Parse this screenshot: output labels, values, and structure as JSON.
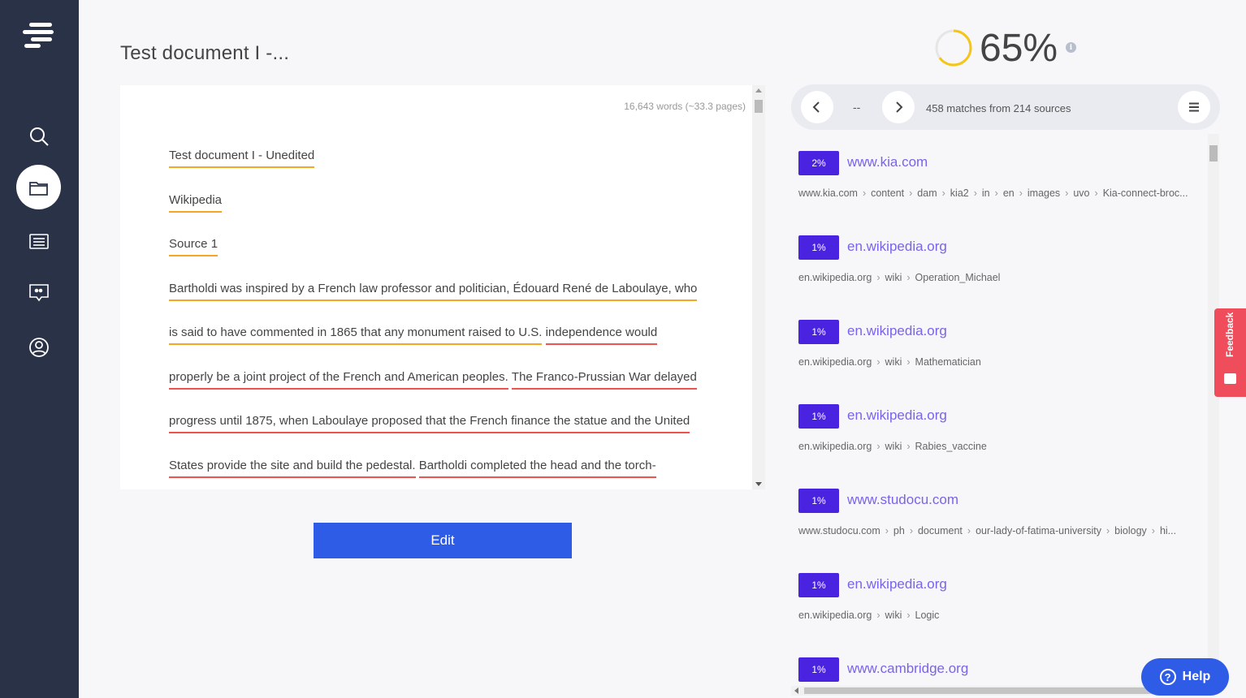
{
  "sidebar": {
    "logo": "copyleaks-logo",
    "items": [
      {
        "icon": "search-icon"
      },
      {
        "icon": "folder-icon",
        "active": true
      },
      {
        "icon": "list-icon"
      },
      {
        "icon": "quote-bubble-icon"
      },
      {
        "icon": "user-icon"
      }
    ]
  },
  "document": {
    "title": "Test document I -...",
    "word_count": "16,643 words (~33.3 pages)",
    "lines": [
      [
        {
          "t": "Test document I - Unedited",
          "c": "orange"
        }
      ],
      [
        {
          "t": "Wikipedia",
          "c": "orange"
        }
      ],
      [
        {
          "t": "Source 1",
          "c": "orange"
        }
      ],
      [
        {
          "t": "Bartholdi was inspired by a French law professor and politician, Édouard René de Laboulaye, who",
          "c": "orange"
        }
      ],
      [
        {
          "t": "is said to have commented in 1865 that any monument raised to U.S.",
          "c": "orange"
        },
        {
          "t": "independence would",
          "c": "red"
        }
      ],
      [
        {
          "t": "properly be a joint project of the French and American peoples.",
          "c": "red"
        },
        {
          "t": "The Franco-Prussian War delayed",
          "c": "red"
        }
      ],
      [
        {
          "t": "progress until 1875, when Laboulaye proposed that the French finance the statue and the United",
          "c": "red"
        }
      ],
      [
        {
          "t": "States provide the site and build the pedestal.",
          "c": "red"
        },
        {
          "t": "Bartholdi completed the head and the torch-",
          "c": "red"
        }
      ]
    ],
    "edit_label": "Edit"
  },
  "score": {
    "value": "65%",
    "fraction": 0.65,
    "ring_color": "#f5c518",
    "info_icon": "i"
  },
  "matches": {
    "cursor": "--",
    "summary": "458 matches from 214 sources",
    "prev_icon": "chevron-left-icon",
    "next_icon": "chevron-right-icon",
    "menu_icon": "menu-icon"
  },
  "sources": [
    {
      "percent": "2%",
      "domain": "www.kia.com",
      "path": [
        "www.kia.com",
        "content",
        "dam",
        "kia2",
        "in",
        "en",
        "images",
        "uvo",
        "Kia-connect-broc..."
      ]
    },
    {
      "percent": "1%",
      "domain": "en.wikipedia.org",
      "path": [
        "en.wikipedia.org",
        "wiki",
        "Operation_Michael"
      ]
    },
    {
      "percent": "1%",
      "domain": "en.wikipedia.org",
      "path": [
        "en.wikipedia.org",
        "wiki",
        "Mathematician"
      ]
    },
    {
      "percent": "1%",
      "domain": "en.wikipedia.org",
      "path": [
        "en.wikipedia.org",
        "wiki",
        "Rabies_vaccine"
      ]
    },
    {
      "percent": "1%",
      "domain": "www.studocu.com",
      "path": [
        "www.studocu.com",
        "ph",
        "document",
        "our-lady-of-fatima-university",
        "biology",
        "hi..."
      ]
    },
    {
      "percent": "1%",
      "domain": "en.wikipedia.org",
      "path": [
        "en.wikipedia.org",
        "wiki",
        "Logic"
      ]
    },
    {
      "percent": "1%",
      "domain": "www.cambridge.org",
      "path": []
    }
  ],
  "feedback": {
    "label": "Feedback"
  },
  "help": {
    "label": "Help",
    "icon": "?"
  }
}
